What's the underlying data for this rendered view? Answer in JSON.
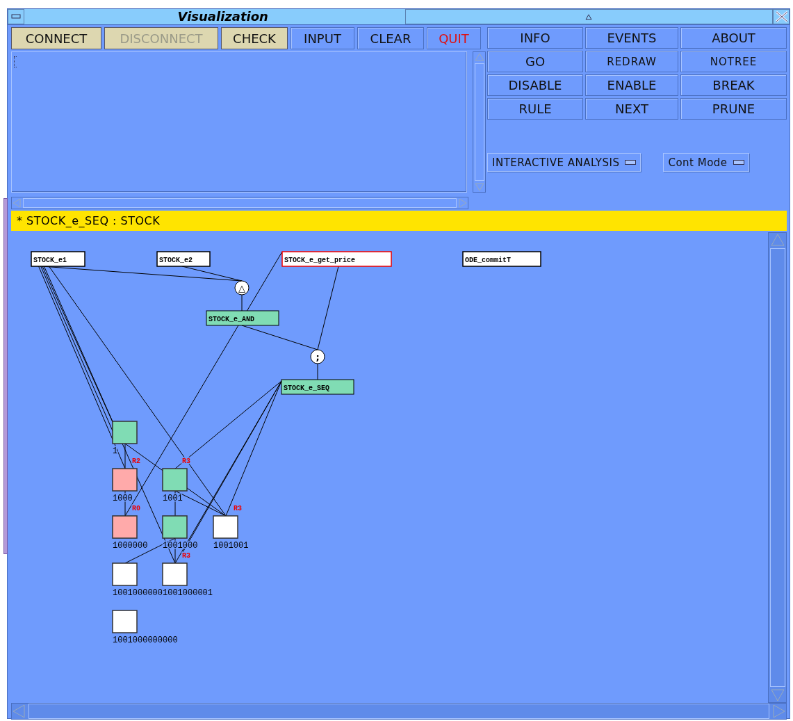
{
  "window": {
    "title": "Visualization"
  },
  "toolbar": [
    {
      "label": "CONNECT",
      "kind": "connection",
      "disabled": false
    },
    {
      "label": "DISCONNECT",
      "kind": "connection",
      "disabled": true
    },
    {
      "label": "CHECK",
      "kind": "connection",
      "disabled": false
    },
    {
      "label": "INPUT",
      "kind": "command",
      "disabled": false
    },
    {
      "label": "CLEAR",
      "kind": "command",
      "disabled": false
    },
    {
      "label": "QUIT",
      "kind": "danger",
      "disabled": false
    }
  ],
  "command_grid": [
    "INFO",
    "EVENTS",
    "ABOUT",
    "GO",
    "REDRAW",
    "NOTREE",
    "DISABLE",
    "ENABLE",
    "BREAK",
    "RULE",
    "NEXT",
    "PRUNE"
  ],
  "menus": [
    {
      "label": "INTERACTIVE ANALYSIS"
    },
    {
      "label": "Cont Mode"
    }
  ],
  "banner": "* STOCK_e_SEQ : STOCK",
  "graph": {
    "events": [
      {
        "label": "STOCK_e1",
        "highlighted": false
      },
      {
        "label": "STOCK_e2",
        "highlighted": false
      },
      {
        "label": "STOCK_e_get_price",
        "highlighted": true
      },
      {
        "label": "ODE_commitT",
        "highlighted": false
      }
    ],
    "operators": [
      {
        "symbol": "△"
      },
      {
        "symbol": ";"
      }
    ],
    "composites": [
      {
        "label": "STOCK_e_AND"
      },
      {
        "label": "STOCK_e_SEQ"
      }
    ],
    "nodes": [
      {
        "label": "1",
        "color": "#80dcb4"
      },
      {
        "label": "1000",
        "color": "#ffaaaa"
      },
      {
        "label": "1001",
        "color": "#80dcb4"
      },
      {
        "label": "1000000",
        "color": "#ffaaaa"
      },
      {
        "label": "1001000",
        "color": "#80dcb4"
      },
      {
        "label": "1001001",
        "color": "#ffffff"
      },
      {
        "label": "1001000000",
        "color": "#ffffff"
      },
      {
        "label": "1001000001",
        "color": "#ffffff"
      },
      {
        "label": "1001000000000",
        "color": "#ffffff"
      }
    ],
    "rule_labels": [
      "R2",
      "R3",
      "R0",
      "R3",
      "R3"
    ]
  }
}
